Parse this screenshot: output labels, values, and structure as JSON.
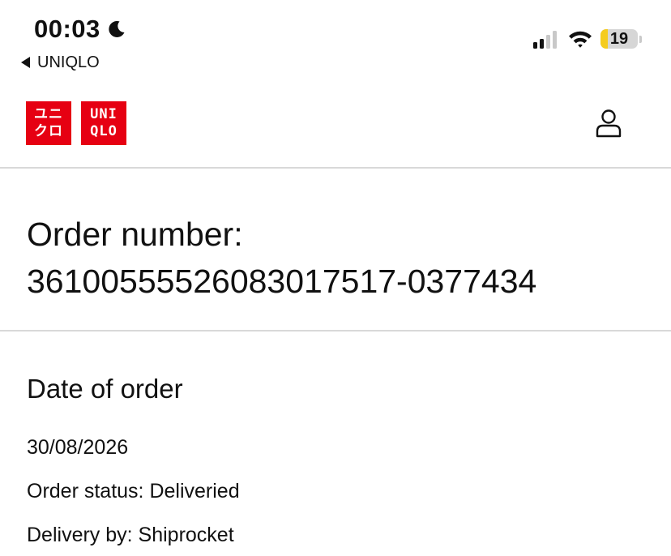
{
  "status_bar": {
    "time": "00:03",
    "back_app_label": "UNIQLO",
    "battery_level": "19",
    "icons": [
      "moon-icon",
      "cellular-signal-icon",
      "wifi-icon",
      "battery-icon"
    ]
  },
  "header": {
    "logo_left_lines": [
      "ユニ",
      "クロ"
    ],
    "logo_right_lines": [
      "UNI",
      "QLO"
    ],
    "account_icon": "user-account-icon",
    "brand_color": "#e60012"
  },
  "order": {
    "number_label": "Order number:",
    "number_value": "36100555526083017517-0377434",
    "date_heading": "Date of order",
    "date_value": "30/08/2026",
    "status_text": "Order status: Deliveried",
    "delivery_text": "Delivery by: Shiprocket"
  }
}
